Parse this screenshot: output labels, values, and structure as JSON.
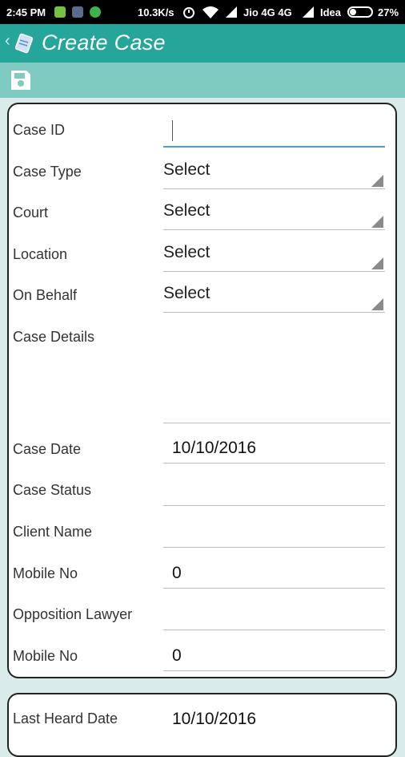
{
  "status_bar": {
    "time": "2:45 PM",
    "net_speed": "10.3K/s",
    "carrier1": "Jio 4G 4G",
    "carrier2": "Idea",
    "battery": "27%"
  },
  "app_bar": {
    "title": "Create Case",
    "color": "#26a69a"
  },
  "form": {
    "case_id": {
      "label": "Case ID",
      "value": ""
    },
    "case_type": {
      "label": "Case Type",
      "value": "Select"
    },
    "court": {
      "label": "Court",
      "value": "Select"
    },
    "location": {
      "label": "Location",
      "value": "Select"
    },
    "on_behalf": {
      "label": "On Behalf",
      "value": "Select"
    },
    "case_details": {
      "label": "Case Details",
      "value": ""
    },
    "case_date": {
      "label": "Case Date",
      "value": "10/10/2016"
    },
    "case_status": {
      "label": "Case Status",
      "value": ""
    },
    "client_name": {
      "label": "Client Name",
      "value": ""
    },
    "mobile_no": {
      "label": "Mobile No",
      "value": "0"
    },
    "opposition_lawyer": {
      "label": "Opposition Lawyer",
      "value": ""
    },
    "opp_mobile_no": {
      "label": "Mobile No",
      "value": "0"
    }
  },
  "form2": {
    "last_heard_date": {
      "label": "Last Heard Date",
      "value": "10/10/2016"
    }
  }
}
